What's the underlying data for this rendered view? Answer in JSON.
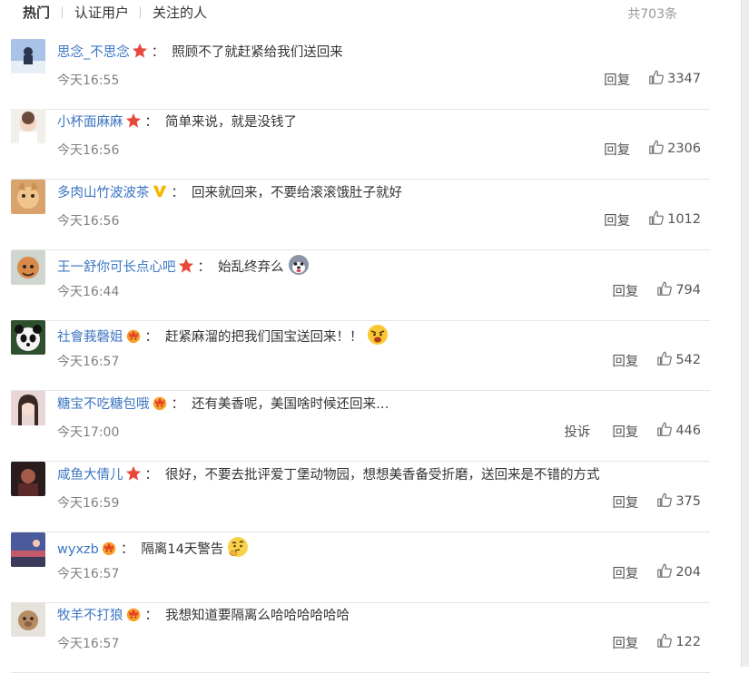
{
  "tabs": {
    "hot": "热门",
    "verified": "认证用户",
    "following": "关注的人",
    "total": "共703条"
  },
  "labels": {
    "reply": "回复",
    "report": "投诉"
  },
  "comments": [
    {
      "user": "思念_不思念",
      "badge": "star",
      "text": "照顾不了就赶紧给我们送回来",
      "time": "今天16:55",
      "likes": "3347",
      "avatar": "av1"
    },
    {
      "user": "小杯面麻麻",
      "badge": "star",
      "text": "简单来说，就是没钱了",
      "time": "今天16:56",
      "likes": "2306",
      "avatar": "av2"
    },
    {
      "user": "多肉山竹波波茶",
      "badge": "v",
      "text": "回来就回来，不要给滚滚饿肚子就好",
      "time": "今天16:56",
      "likes": "1012",
      "avatar": "av3"
    },
    {
      "user": "王一舒你可长点心吧",
      "badge": "star",
      "text": "始乱终弃么",
      "emoji": "husky",
      "time": "今天16:44",
      "likes": "794",
      "avatar": "av4"
    },
    {
      "user": "社會莪磬姐",
      "badge": "crown",
      "text": "赶紧麻溜的把我们国宝送回来！！",
      "emoji": "angry",
      "time": "今天16:57",
      "likes": "542",
      "avatar": "av5"
    },
    {
      "user": "糖宝不吃糖包哦",
      "badge": "crown",
      "text": "还有美香呢，美国啥时候还回来…",
      "time": "今天17:00",
      "likes": "446",
      "report": true,
      "avatar": "av6"
    },
    {
      "user": "咸鱼大倩儿",
      "badge": "star",
      "text": "很好，不要去批评爱丁堡动物园，想想美香备受折磨，送回来是不错的方式",
      "time": "今天16:59",
      "likes": "375",
      "avatar": "av7"
    },
    {
      "user": "wyxzb",
      "badge": "crown",
      "text": "隔离14天警告",
      "emoji": "think",
      "time": "今天16:57",
      "likes": "204",
      "avatar": "av8"
    },
    {
      "user": "牧羊不打狼",
      "badge": "crown",
      "text": "我想知道要隔离么哈哈哈哈哈哈",
      "time": "今天16:57",
      "likes": "122",
      "avatar": "av9"
    }
  ]
}
